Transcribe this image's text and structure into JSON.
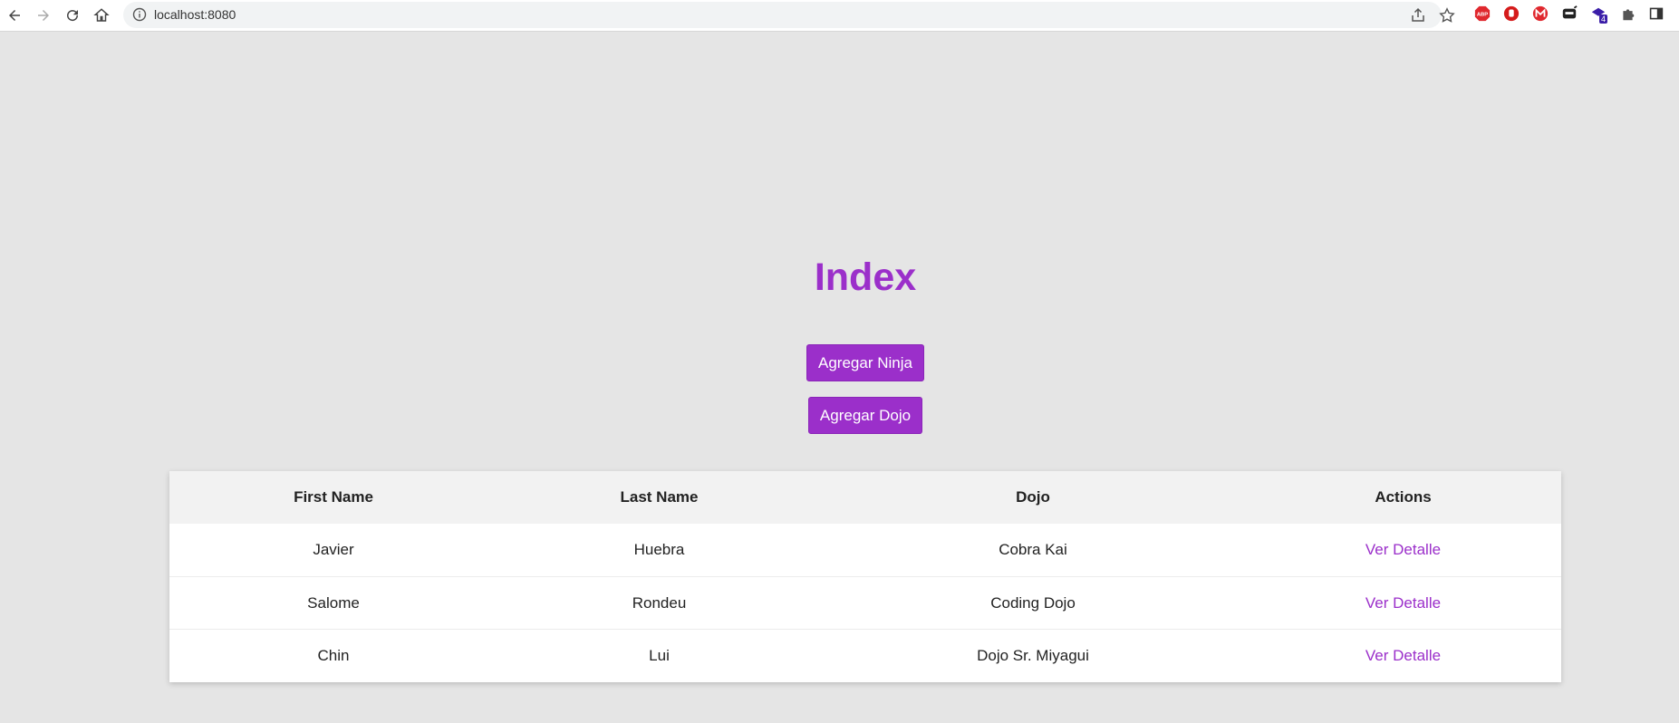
{
  "browser": {
    "url": "localhost:8080",
    "extensions": [
      "abp-icon",
      "stop-extension-icon",
      "mail-extension-icon",
      "ninja-extension-icon",
      "badge-extension-icon",
      "puzzle-icon",
      "sidebar-icon"
    ],
    "badge_count": "4"
  },
  "page": {
    "title": "Index",
    "buttons": {
      "add_ninja": "Agregar Ninja",
      "add_dojo": "Agregar Dojo"
    },
    "table": {
      "headers": [
        "First Name",
        "Last Name",
        "Dojo",
        "Actions"
      ],
      "rows": [
        {
          "first": "Javier",
          "last": "Huebra",
          "dojo": "Cobra Kai",
          "action": "Ver Detalle"
        },
        {
          "first": "Salome",
          "last": "Rondeu",
          "dojo": "Coding Dojo",
          "action": "Ver Detalle"
        },
        {
          "first": "Chin",
          "last": "Lui",
          "dojo": "Dojo Sr. Miyagui",
          "action": "Ver Detalle"
        }
      ]
    }
  },
  "colors": {
    "accent": "#9b2fca",
    "background": "#e5e5e5"
  }
}
